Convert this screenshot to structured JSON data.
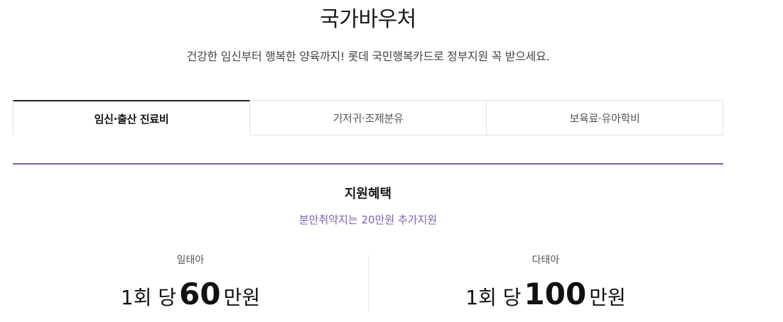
{
  "header": {
    "title": "국가바우처",
    "subtitle": "건강한 임신부터 행복한 양육까지! 롯데 국민행복카드로 정부지원 꼭 받으세요."
  },
  "tabs": [
    {
      "label": "임신·출산 진료비",
      "active": true
    },
    {
      "label": "기저귀·조제분유",
      "active": false
    },
    {
      "label": "보육료·유아학비",
      "active": false
    }
  ],
  "section": {
    "title": "지원혜택",
    "note": "분만취약지는 20만원 추가지원"
  },
  "benefits": [
    {
      "label": "일태아",
      "prefix": "1회 당",
      "amount": "60",
      "suffix": "만원"
    },
    {
      "label": "다태아",
      "prefix": "1회 당",
      "amount": "100",
      "suffix": "만원"
    }
  ],
  "colors": {
    "accent": "#7b5ea7",
    "active_tab_border": "#222222"
  }
}
